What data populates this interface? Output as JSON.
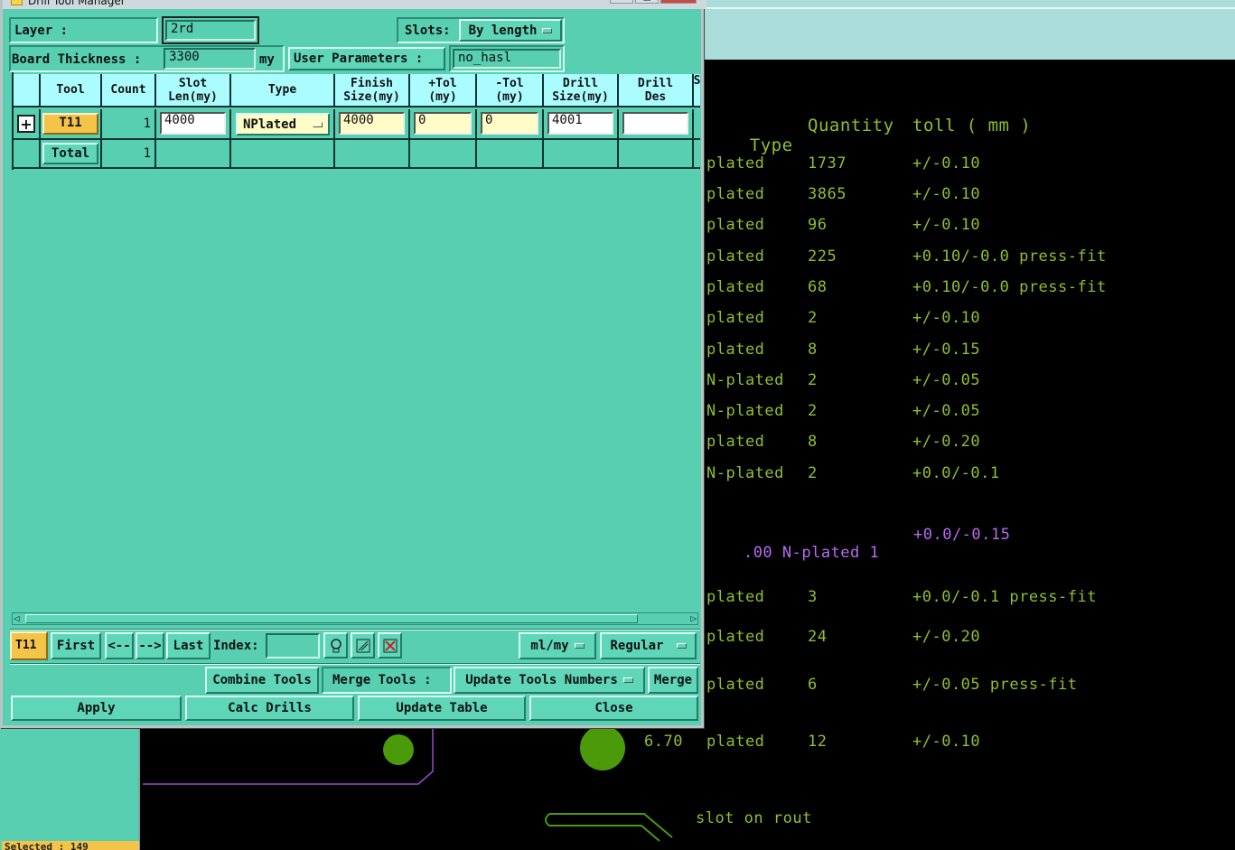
{
  "window": {
    "title": "Drill Tool Manager"
  },
  "header": {
    "layer_label": "Layer :",
    "layer_value": "2rd",
    "slots_label": "Slots:",
    "slots_value": "By length",
    "board_thickness_label": "Board Thickness :",
    "board_thickness_value": "3300",
    "board_thickness_unit": "my",
    "user_params_label": "User Parameters :",
    "user_params_value": "no_hasl"
  },
  "table": {
    "columns": [
      "Tool",
      "Count",
      "Slot Len(my)",
      "Type",
      "Finish Size(my)",
      "+Tol (my)",
      "-Tol (my)",
      "Drill Size(my)",
      "Drill Des",
      "S"
    ],
    "columns_lines": [
      [
        "Tool"
      ],
      [
        "Count"
      ],
      [
        "Slot",
        "Len(my)"
      ],
      [
        "Type"
      ],
      [
        "Finish",
        "Size(my)"
      ],
      [
        "+Tol",
        "(my)"
      ],
      [
        "-Tol",
        "(my)"
      ],
      [
        "Drill",
        "Size(my)"
      ],
      [
        "Drill",
        "Des"
      ],
      [
        "S"
      ]
    ],
    "row": {
      "tool": "T11",
      "count": "1",
      "slot_len": "4000",
      "type": "NPlated",
      "finish_size": "4000",
      "plus_tol": "0",
      "minus_tol": "0",
      "drill_size": "4001",
      "drill_des": ""
    },
    "total": {
      "label": "Total",
      "count": "1"
    }
  },
  "nav": {
    "current_tool": "T11",
    "first": "First",
    "prev": "<--",
    "next": "-->",
    "last": "Last",
    "index_label": "Index:",
    "index_value": "",
    "units": "ml/my",
    "mode": "Regular"
  },
  "actions": {
    "combine": "Combine Tools",
    "merge_tools_label": "Merge Tools :",
    "update_numbers": "Update Tools Numbers",
    "merge": "Merge",
    "apply": "Apply",
    "calc": "Calc Drills",
    "update_table": "Update Table",
    "close": "Close"
  },
  "background": {
    "header": {
      "type": "Type",
      "quantity": "Quantity",
      "toll": "toll ( mm )"
    },
    "rows": [
      {
        "type": "plated",
        "qty": "1737",
        "tol": "+/-0.10"
      },
      {
        "type": "plated",
        "qty": "3865",
        "tol": "+/-0.10"
      },
      {
        "type": "plated",
        "qty": "96",
        "tol": "+/-0.10"
      },
      {
        "type": "plated",
        "qty": "225",
        "tol": "+0.10/-0.0 press-fit"
      },
      {
        "type": "plated",
        "qty": "68",
        "tol": "+0.10/-0.0 press-fit"
      },
      {
        "type": "plated",
        "qty": "2",
        "tol": "+/-0.10"
      },
      {
        "type": "plated",
        "qty": "8",
        "tol": "+/-0.15"
      },
      {
        "type": "N-plated",
        "qty": "2",
        "tol": "+/-0.05"
      },
      {
        "type": "N-plated",
        "qty": "2",
        "tol": "+/-0.05"
      },
      {
        "type": "plated",
        "qty": "8",
        "tol": "+/-0.20"
      },
      {
        "type": "N-plated",
        "qty": "2",
        "tol": "+0.0/-0.1"
      }
    ],
    "purple_row": {
      "text": ".00 N-plated 1",
      "tol": "+0.0/-0.15"
    },
    "rows2": [
      {
        "type": "plated",
        "qty": "3",
        "tol": "+0.0/-0.1 press-fit"
      },
      {
        "type": "plated",
        "qty": "24",
        "tol": "+/-0.20"
      },
      {
        "type": "plated",
        "qty": "6",
        "tol": "+/-0.05 press-fit"
      }
    ],
    "last_row": {
      "size": "6.70",
      "type": "plated",
      "qty": "12",
      "tol": "+/-0.10"
    },
    "slot_note": "slot on rout",
    "selected": "Selected : 149",
    "colors": {
      "drill_text": "#8fbf2f",
      "purple": "#b46cf0",
      "pad": "#4a9a0a",
      "outline": "#9a4bc8"
    }
  }
}
